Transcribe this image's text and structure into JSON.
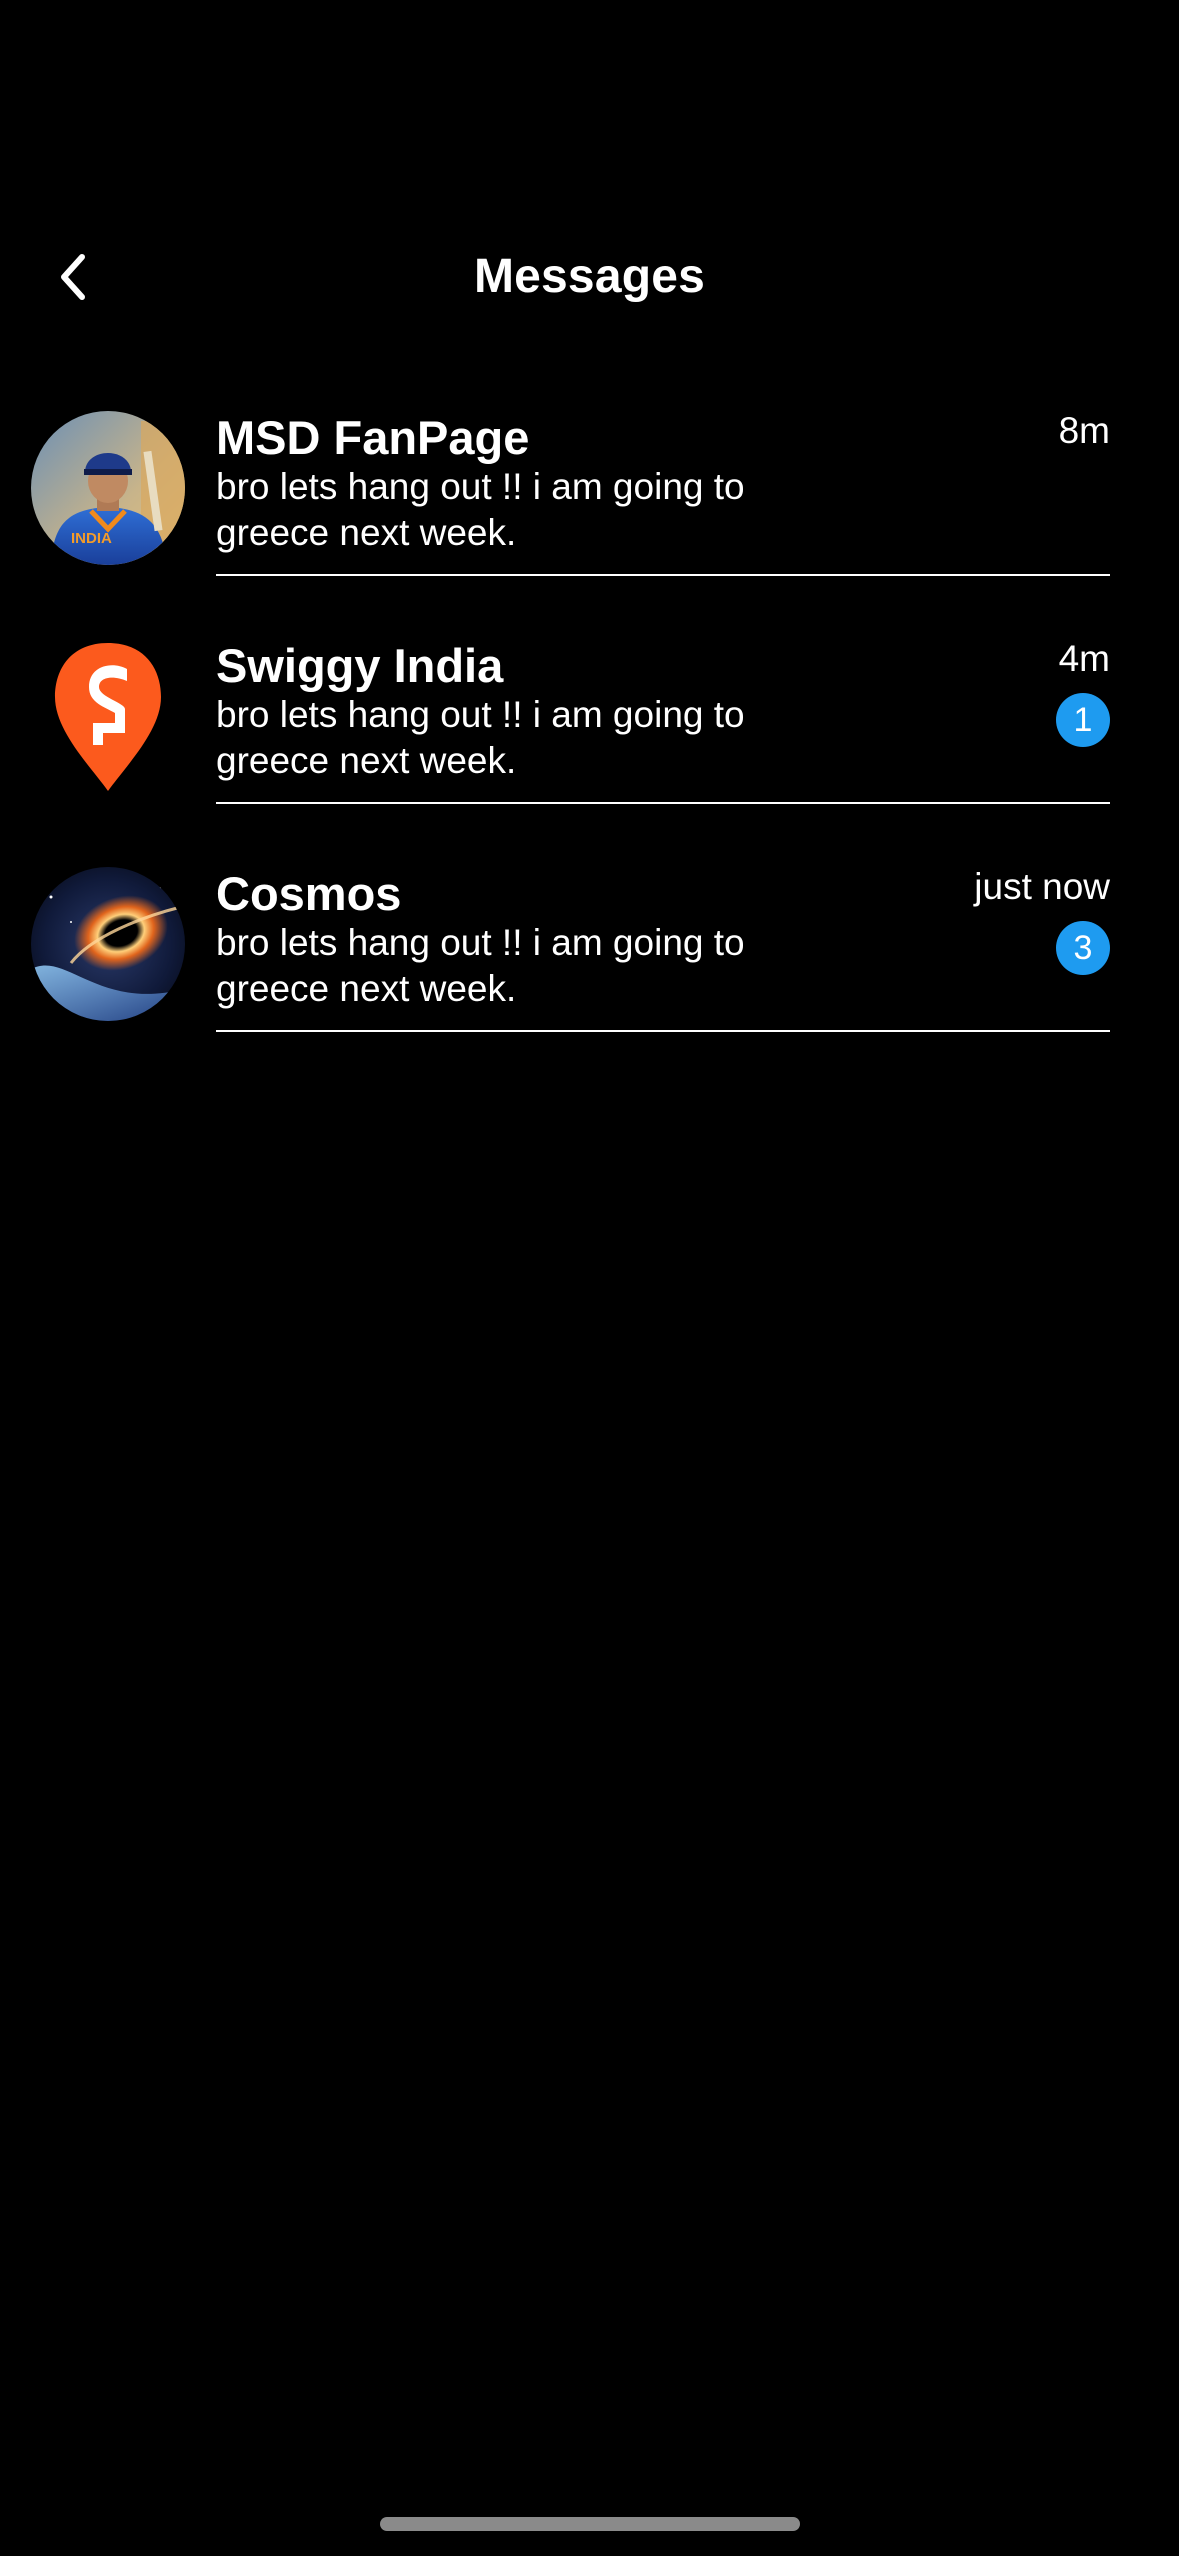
{
  "header": {
    "title": "Messages",
    "back_icon": "chevron-left-icon"
  },
  "conversations": [
    {
      "name": "MSD FanPage",
      "preview": "bro lets hang out !! i am going to greece next week.",
      "time": "8m",
      "unread": null,
      "avatar": "cricketer-photo",
      "avatar_jersey_text": "INDIA"
    },
    {
      "name": "Swiggy India",
      "preview": "bro lets hang out !! i am going to greece next week.",
      "time": "4m",
      "unread": "1",
      "avatar": "swiggy-logo",
      "brand_color": "#fc5a1d"
    },
    {
      "name": "Cosmos",
      "preview": "bro lets hang out !! i am going to greece next week.",
      "time": "just now",
      "unread": "3",
      "avatar": "black-hole-image"
    }
  ],
  "colors": {
    "background": "#000000",
    "text": "#ffffff",
    "badge": "#1e9bf0",
    "home_indicator": "#8a8a8a"
  }
}
